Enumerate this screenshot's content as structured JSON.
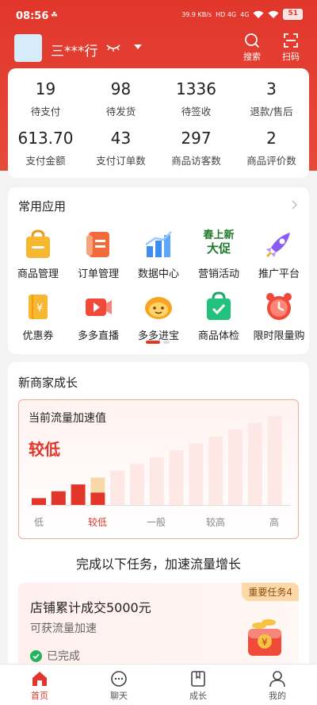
{
  "status_bar": {
    "time": "08:56",
    "speed": "39.9 KB/s",
    "network_1": "HD 4G",
    "network_2": "4G",
    "battery": "51"
  },
  "header": {
    "shop_name": "三***行",
    "search_label": "搜索",
    "scan_label": "扫码"
  },
  "stats": [
    {
      "value": "19",
      "label": "待支付"
    },
    {
      "value": "98",
      "label": "待发货"
    },
    {
      "value": "1336",
      "label": "待签收"
    },
    {
      "value": "3",
      "label": "退款/售后"
    },
    {
      "value": "613.70",
      "label": "支付金额"
    },
    {
      "value": "43",
      "label": "支付订单数"
    },
    {
      "value": "297",
      "label": "商品访客数"
    },
    {
      "value": "2",
      "label": "商品评价数"
    }
  ],
  "apps": {
    "title": "常用应用",
    "items": [
      {
        "label": "商品管理",
        "icon": "shopping-bag-icon"
      },
      {
        "label": "订单管理",
        "icon": "order-scroll-icon"
      },
      {
        "label": "数据中心",
        "icon": "bar-chart-icon"
      },
      {
        "label": "营销活动",
        "icon": "promotion-text-icon",
        "icon_text_1": "春上新",
        "icon_text_2": "大促"
      },
      {
        "label": "推广平台",
        "icon": "rocket-icon"
      },
      {
        "label": "优惠券",
        "icon": "coupon-icon"
      },
      {
        "label": "多多直播",
        "icon": "live-video-icon"
      },
      {
        "label": "多多进宝",
        "icon": "mascot-icon"
      },
      {
        "label": "商品体检",
        "icon": "check-bag-icon"
      },
      {
        "label": "限时限量购",
        "icon": "alarm-clock-icon"
      }
    ]
  },
  "growth": {
    "title": "新商家成长",
    "chart_title": "当前流量加速值",
    "current_level": "较低",
    "task_heading": "完成以下任务，加速流量增长",
    "task": {
      "title": "店铺累计成交5000元",
      "subtitle": "可获流量加速",
      "status": "已完成",
      "badge": "重要任务4"
    }
  },
  "chart_data": {
    "type": "bar",
    "categories": [
      "低",
      "较低",
      "一般",
      "较高",
      "高"
    ],
    "values": [
      1,
      2,
      3,
      4,
      5,
      6,
      7,
      8,
      9,
      10,
      11,
      12,
      13
    ],
    "current_index": 3,
    "current_category": "较低"
  },
  "tabbar": [
    {
      "label": "首页",
      "active": true
    },
    {
      "label": "聊天",
      "active": false
    },
    {
      "label": "成长",
      "active": false
    },
    {
      "label": "我的",
      "active": false
    }
  ],
  "colors": {
    "brand_red": "#e2362b",
    "bar_filled": "#e2362b",
    "bar_current_top": "#f7d9a8",
    "bar_empty": "#fde8e6"
  }
}
